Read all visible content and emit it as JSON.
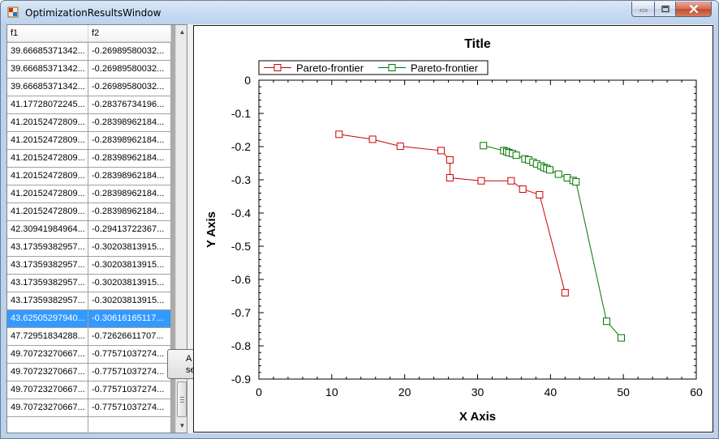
{
  "window": {
    "title": "OptimizationResultsWindow"
  },
  "grid": {
    "columns": [
      "f1",
      "f2"
    ],
    "selected_index": 15,
    "rows": [
      [
        "39.66685371342...",
        "-0.26989580032..."
      ],
      [
        "39.66685371342...",
        "-0.26989580032..."
      ],
      [
        "39.66685371342...",
        "-0.26989580032..."
      ],
      [
        "41.17728072245...",
        "-0.28376734196..."
      ],
      [
        "41.20152472809...",
        "-0.28398962184..."
      ],
      [
        "41.20152472809...",
        "-0.28398962184..."
      ],
      [
        "41.20152472809...",
        "-0.28398962184..."
      ],
      [
        "41.20152472809...",
        "-0.28398962184..."
      ],
      [
        "41.20152472809...",
        "-0.28398962184..."
      ],
      [
        "41.20152472809...",
        "-0.28398962184..."
      ],
      [
        "42.30941984964...",
        "-0.29413722367..."
      ],
      [
        "43.17359382957...",
        "-0.30203813915..."
      ],
      [
        "43.17359382957...",
        "-0.30203813915..."
      ],
      [
        "43.17359382957...",
        "-0.30203813915..."
      ],
      [
        "43.17359382957...",
        "-0.30203813915..."
      ],
      [
        "43.62505297940...",
        "-0.30616165117..."
      ],
      [
        "47.72951834288...",
        "-0.72626611707..."
      ],
      [
        "49.70723270667...",
        "-0.77571037274..."
      ],
      [
        "49.70723270667...",
        "-0.77571037274..."
      ],
      [
        "49.70723270667...",
        "-0.77571037274..."
      ],
      [
        "49.70723270667...",
        "-0.77571037274..."
      ],
      [
        "",
        ""
      ]
    ],
    "partial_button_text": "A\nsel"
  },
  "colors": {
    "series1": "#cc0000",
    "series2": "#007700",
    "selection": "#3399ff"
  },
  "chart_data": {
    "type": "line",
    "title": "Title",
    "xlabel": "X Axis",
    "ylabel": "Y Axis",
    "xlim": [
      0,
      60
    ],
    "ylim": [
      -0.9,
      0.0
    ],
    "xticks": [
      0,
      10,
      20,
      30,
      40,
      50,
      60
    ],
    "yticks": [
      0.0,
      -0.1,
      -0.2,
      -0.3,
      -0.4,
      -0.5,
      -0.6,
      -0.7,
      -0.8,
      -0.9
    ],
    "legend_position": "top-left",
    "grid": false,
    "series": [
      {
        "name": "Pareto-frontier",
        "color": "#cc0000",
        "marker": "square",
        "points": [
          [
            11.0,
            -0.163
          ],
          [
            15.6,
            -0.178
          ],
          [
            19.4,
            -0.199
          ],
          [
            25.0,
            -0.212
          ],
          [
            26.2,
            -0.24
          ],
          [
            26.2,
            -0.294
          ],
          [
            30.5,
            -0.303
          ],
          [
            34.6,
            -0.303
          ],
          [
            36.2,
            -0.328
          ],
          [
            38.5,
            -0.345
          ],
          [
            42.0,
            -0.64
          ]
        ]
      },
      {
        "name": "Pareto-frontier",
        "color": "#007700",
        "marker": "square",
        "points": [
          [
            30.8,
            -0.197
          ],
          [
            33.6,
            -0.212
          ],
          [
            34.0,
            -0.215
          ],
          [
            34.3,
            -0.218
          ],
          [
            34.8,
            -0.221
          ],
          [
            35.3,
            -0.226
          ],
          [
            36.5,
            -0.237
          ],
          [
            37.0,
            -0.24
          ],
          [
            37.6,
            -0.247
          ],
          [
            38.1,
            -0.252
          ],
          [
            38.7,
            -0.258
          ],
          [
            39.1,
            -0.263
          ],
          [
            39.5,
            -0.266
          ],
          [
            39.9,
            -0.27
          ],
          [
            41.1,
            -0.283
          ],
          [
            42.3,
            -0.294
          ],
          [
            43.1,
            -0.302
          ],
          [
            43.5,
            -0.306
          ],
          [
            47.7,
            -0.726
          ],
          [
            49.7,
            -0.776
          ]
        ]
      }
    ]
  }
}
